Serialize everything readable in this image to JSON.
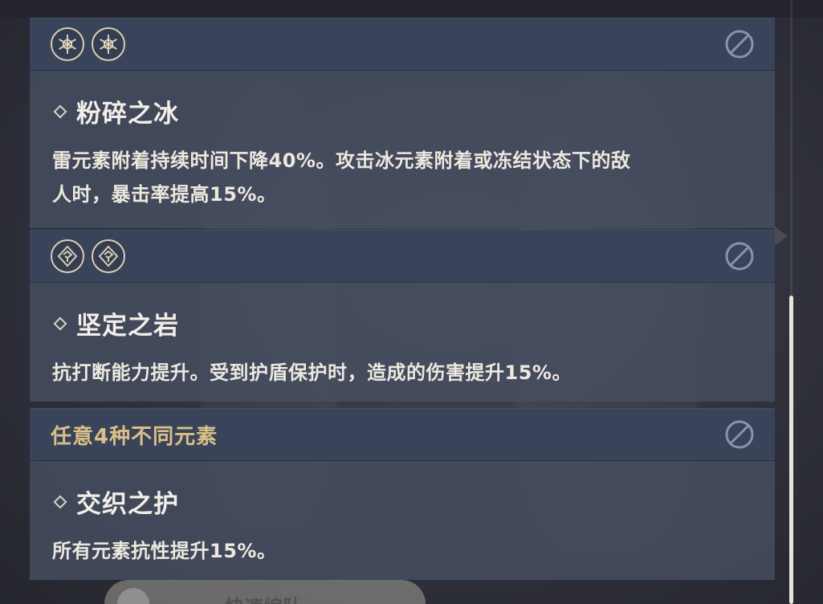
{
  "resonances": [
    {
      "header_icons": [
        "cryo-element-icon",
        "cryo-element-icon"
      ],
      "title": "粉碎之冰",
      "description_lines": [
        "雷元素附着持续时间下降40%。攻击冰元素附着或冻结状态下的敌",
        "人时，暴击率提高15%。"
      ]
    },
    {
      "header_icons": [
        "geo-element-icon",
        "geo-element-icon"
      ],
      "title": "坚定之岩",
      "description_lines": [
        "抗打断能力提升。受到护盾保护时，造成的伤害提升15%。"
      ]
    },
    {
      "header_text": "任意4种不同元素",
      "title": "交织之护",
      "description_lines": [
        "所有元素抗性提升15%。"
      ]
    }
  ],
  "bottom_button": {
    "label": "快速编队"
  },
  "colors": {
    "header_bg": "#39435a",
    "body_bg": "#464e62",
    "gold_text": "#d9bf86",
    "icon_ring": "#d9ceb5"
  }
}
